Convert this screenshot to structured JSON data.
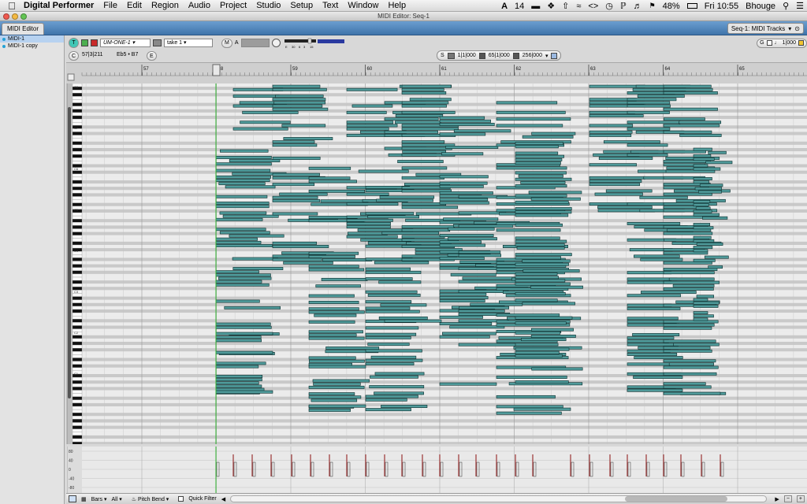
{
  "menubar": {
    "app_name": "Digital Performer",
    "menus": [
      "File",
      "Edit",
      "Region",
      "Audio",
      "Project",
      "Studio",
      "Setup",
      "Text",
      "Window",
      "Help"
    ],
    "status": {
      "adobe_count": "14",
      "battery": "48%",
      "clock": "Fri 10:55",
      "user": "Bhouge"
    }
  },
  "window": {
    "title": "MIDI Editor: Seq-1"
  },
  "tabs": {
    "active": "MIDI Editor",
    "sequence_selector": "Seq-1: MIDI Tracks"
  },
  "tracks": [
    {
      "name": "MIDI-1",
      "selected": true
    },
    {
      "name": "MIDI-1 copy",
      "selected": false
    }
  ],
  "toolbar": {
    "device": "UM-ONE-1",
    "take": "take 1",
    "m_label": "M",
    "a_label": "A",
    "g_label": "G",
    "grid_value": "1|000",
    "c_label": "C",
    "counter": "57|3|211",
    "pitch_range": "Eb5 • B7",
    "e_label": "E",
    "s_label": "S",
    "snap1": "1|1|000",
    "snap2": "65|1|000",
    "snap3": "256|000",
    "mini_meter_ticks": [
      "E",
      "30",
      "6",
      "3",
      "15"
    ]
  },
  "ruler": {
    "bars": [
      "57",
      "58",
      "59",
      "60",
      "61",
      "62",
      "63",
      "64",
      "65"
    ]
  },
  "keyboard": {
    "octave_labels": [
      "C8",
      "C7",
      "C6",
      "C5",
      "C4",
      "C3",
      "C2",
      "C1"
    ]
  },
  "velocity": {
    "axis_labels": [
      "80",
      "40",
      "0",
      "-40",
      "-80"
    ]
  },
  "bottombar": {
    "bars_label": "Bars",
    "all_label": "All",
    "controller": "Pitch Bend",
    "quick_filter": "Quick Filter"
  },
  "colors": {
    "note_fill": "#4f9a9a",
    "note_border": "#0b2b2b",
    "tab_bar": "#4a7db3",
    "playhead": "#2fb52f",
    "velocity_stem": "#8a1010"
  }
}
